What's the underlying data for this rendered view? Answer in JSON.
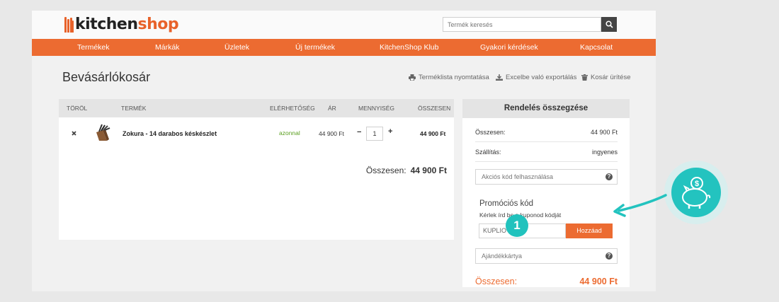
{
  "brand": {
    "part1": "kitchen",
    "part2": "shop",
    "color": "#ec6b31"
  },
  "search": {
    "placeholder": "Termék keresés"
  },
  "nav": [
    "Termékek",
    "Márkák",
    "Üzletek",
    "Új termékek",
    "KitchenShop Klub",
    "Gyakori kérdések",
    "Kapcsolat"
  ],
  "page_title": "Bevásárlókosár",
  "actions": {
    "print": "Terméklista nyomtatása",
    "export": "Excelbe való exportálás",
    "clear": "Kosár ürítése"
  },
  "cart": {
    "headers": {
      "remove": "TÖRÖL",
      "product": "TERMÉK",
      "availability": "ELÉRHETŐSÉG",
      "price": "ÁR",
      "quantity": "MENNYISÉG",
      "total": "ÖSSZESEN"
    },
    "item": {
      "name": "Zokura - 14 darabos késkészlet",
      "availability": "azonnal",
      "price": "44 900 Ft",
      "quantity": "1",
      "total": "44 900 Ft",
      "remove_icon": "close-icon"
    },
    "total_label": "Összesen:",
    "total_value": "44 900 Ft"
  },
  "summary": {
    "title": "Rendelés összegzése",
    "subtotal_label": "Összesen:",
    "subtotal_value": "44 900 Ft",
    "shipping_label": "Szállítás:",
    "shipping_value": "ingyenes",
    "coupon_field": "Akciós kód felhasználása",
    "promo_title": "Promóciós kód",
    "promo_subtitle": "Kérlek írd be a kuponod kódját",
    "promo_input_value": "KUPLIO",
    "promo_button": "Hozzáad",
    "gift_card_field": "Ajándékkártya",
    "grand_label": "Összesen:",
    "grand_value": "44 900 Ft"
  },
  "step_badge": "1",
  "colors": {
    "accent": "#ec6b31",
    "teal": "#23c3bf",
    "available": "#5a9e1f"
  }
}
